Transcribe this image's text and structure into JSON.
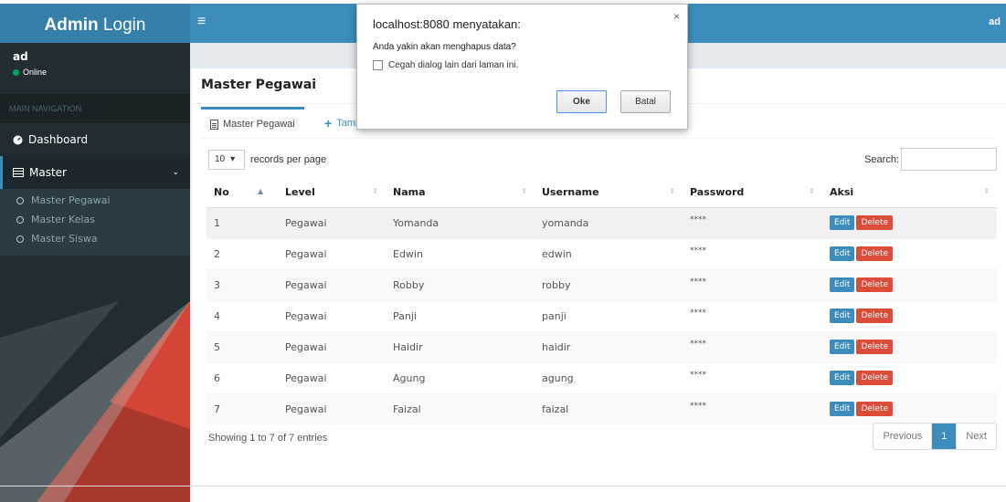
{
  "sidebar": {
    "logo_bold": "Admin",
    "logo_rest": " Login",
    "user_name": "ad",
    "user_status": "Online",
    "nav_header": "MAIN NAVIGATION",
    "items": [
      {
        "label": "Dashboard",
        "icon": "dashboard-icon"
      },
      {
        "label": "Master",
        "icon": "table-icon"
      }
    ],
    "submenu": [
      "Master Pegawai",
      "Master Kelas",
      "Master Siswa"
    ]
  },
  "header": {
    "user": "ad"
  },
  "page": {
    "title": "Master Pegawai",
    "tabs": [
      "Master Pegawai",
      "Tamb"
    ],
    "length_value": "10",
    "length_label": "records per page",
    "search_label": "Search:",
    "columns": [
      "No",
      "Level",
      "Nama",
      "Username",
      "Password",
      "Aksi"
    ],
    "rows": [
      [
        "1",
        "Pegawai",
        "Yomanda",
        "yomanda",
        "****"
      ],
      [
        "2",
        "Pegawai",
        "Edwin",
        "edwin",
        "****"
      ],
      [
        "3",
        "Pegawai",
        "Robby",
        "robby",
        "****"
      ],
      [
        "4",
        "Pegawai",
        "Panji",
        "panji",
        "****"
      ],
      [
        "5",
        "Pegawai",
        "Haidir",
        "haidir",
        "****"
      ],
      [
        "6",
        "Pegawai",
        "Agung",
        "agung",
        "****"
      ],
      [
        "7",
        "Pegawai",
        "Faizal",
        "faizal",
        "****"
      ]
    ],
    "edit_label": "Edit",
    "delete_label": "Delete",
    "info": "Showing 1 to 7 of 7 entries",
    "pager": {
      "prev": "Previous",
      "current": "1",
      "next": "Next"
    }
  },
  "dialog": {
    "title": "localhost:8080 menyatakan:",
    "message": "Anda yakin akan menghapus data?",
    "checkbox_label": "Cegah dialog lain dari laman ini.",
    "ok": "Oke",
    "cancel": "Batal"
  },
  "colors": {
    "accent": "#3c8dbc",
    "sidebar": "#222d32",
    "danger": "#dd4b39"
  }
}
